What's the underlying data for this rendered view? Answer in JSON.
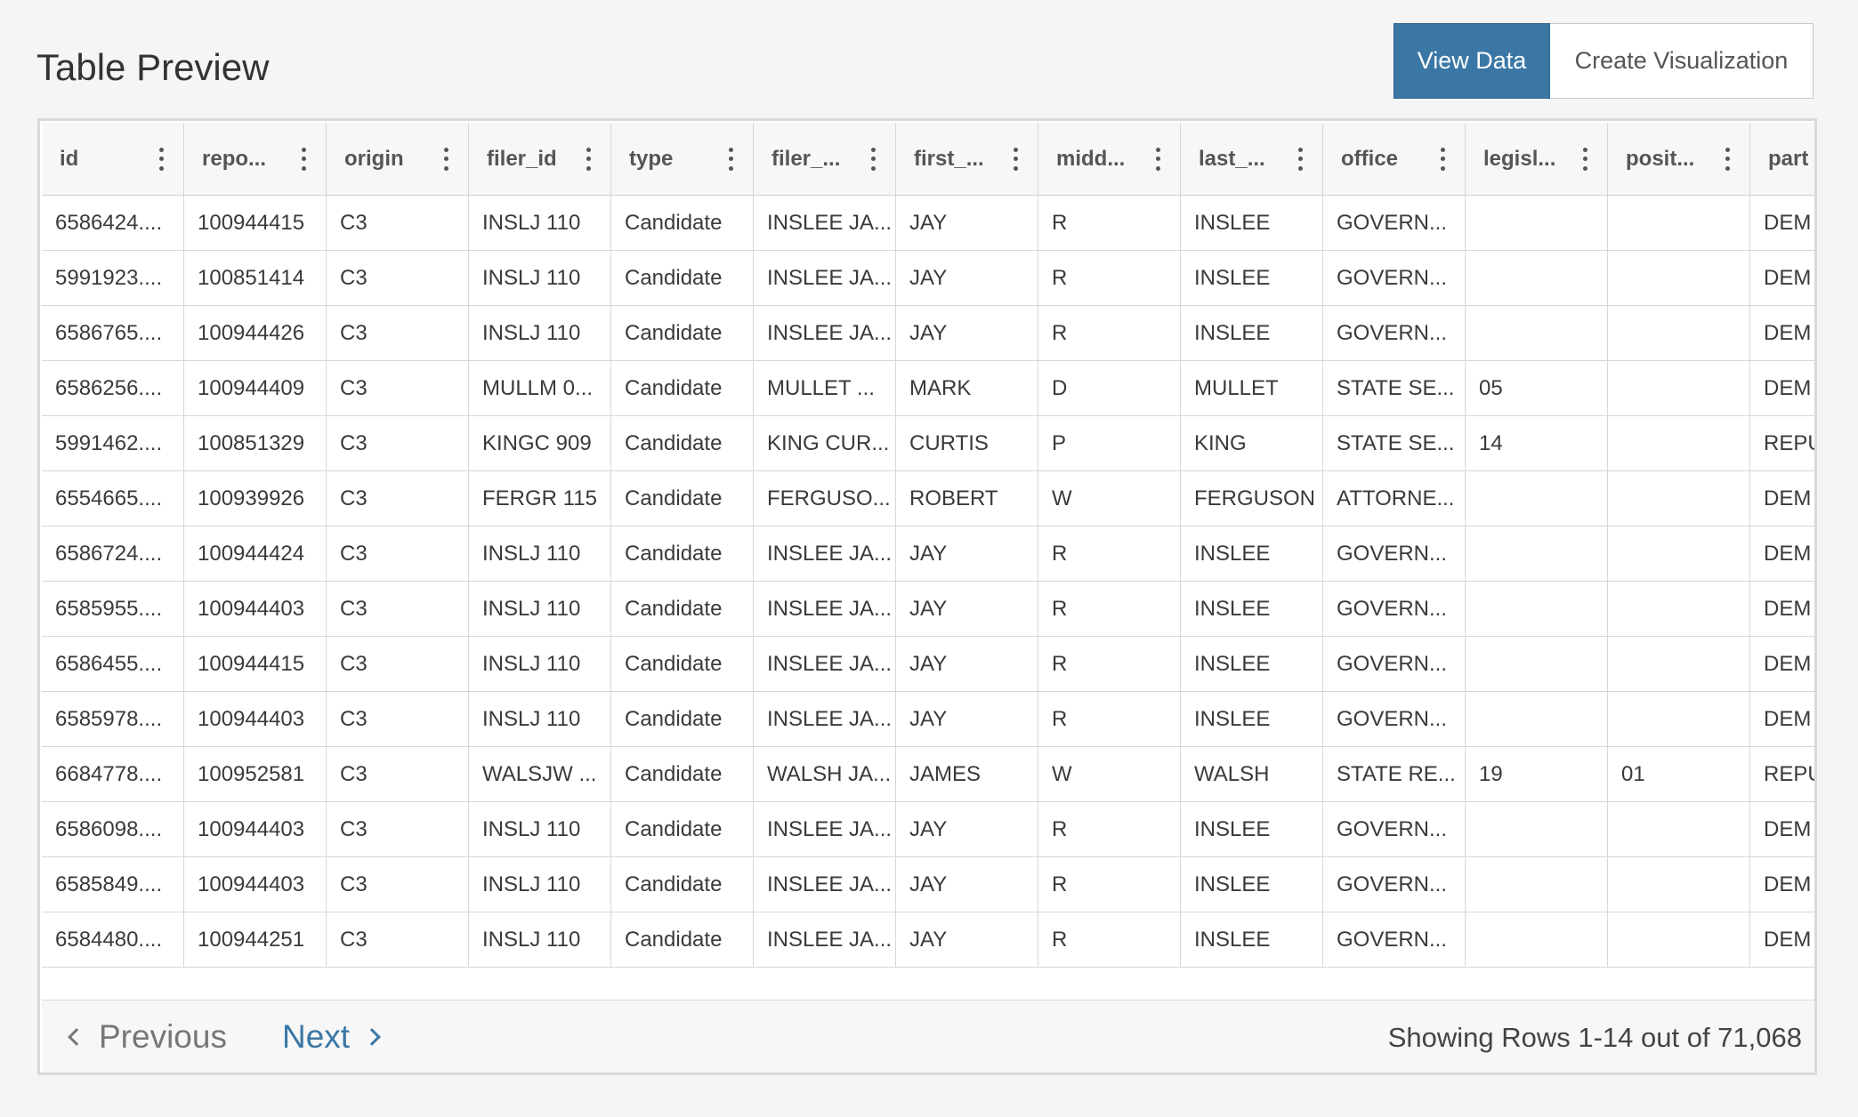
{
  "header": {
    "title": "Table Preview",
    "view_data_label": "View Data",
    "create_viz_label": "Create Visualization"
  },
  "table": {
    "columns": [
      "id",
      "repo...",
      "origin",
      "filer_id",
      "type",
      "filer_...",
      "first_...",
      "midd...",
      "last_...",
      "office",
      "legisl...",
      "posit...",
      "part"
    ],
    "rows": [
      [
        "6586424....",
        "100944415",
        "C3",
        "INSLJ 110",
        "Candidate",
        "INSLEE JA...",
        "JAY",
        "R",
        "INSLEE",
        "GOVERN...",
        "",
        "",
        "DEM"
      ],
      [
        "5991923....",
        "100851414",
        "C3",
        "INSLJ 110",
        "Candidate",
        "INSLEE JA...",
        "JAY",
        "R",
        "INSLEE",
        "GOVERN...",
        "",
        "",
        "DEM"
      ],
      [
        "6586765....",
        "100944426",
        "C3",
        "INSLJ 110",
        "Candidate",
        "INSLEE JA...",
        "JAY",
        "R",
        "INSLEE",
        "GOVERN...",
        "",
        "",
        "DEM"
      ],
      [
        "6586256....",
        "100944409",
        "C3",
        "MULLM 0...",
        "Candidate",
        "MULLET ...",
        "MARK",
        "D",
        "MULLET",
        "STATE SE...",
        "05",
        "",
        "DEM"
      ],
      [
        "5991462....",
        "100851329",
        "C3",
        "KINGC 909",
        "Candidate",
        "KING CUR...",
        "CURTIS",
        "P",
        "KING",
        "STATE SE...",
        "14",
        "",
        "REPU"
      ],
      [
        "6554665....",
        "100939926",
        "C3",
        "FERGR 115",
        "Candidate",
        "FERGUSO...",
        "ROBERT",
        "W",
        "FERGUSON",
        "ATTORNE...",
        "",
        "",
        "DEM"
      ],
      [
        "6586724....",
        "100944424",
        "C3",
        "INSLJ 110",
        "Candidate",
        "INSLEE JA...",
        "JAY",
        "R",
        "INSLEE",
        "GOVERN...",
        "",
        "",
        "DEM"
      ],
      [
        "6585955....",
        "100944403",
        "C3",
        "INSLJ 110",
        "Candidate",
        "INSLEE JA...",
        "JAY",
        "R",
        "INSLEE",
        "GOVERN...",
        "",
        "",
        "DEM"
      ],
      [
        "6586455....",
        "100944415",
        "C3",
        "INSLJ 110",
        "Candidate",
        "INSLEE JA...",
        "JAY",
        "R",
        "INSLEE",
        "GOVERN...",
        "",
        "",
        "DEM"
      ],
      [
        "6585978....",
        "100944403",
        "C3",
        "INSLJ 110",
        "Candidate",
        "INSLEE JA...",
        "JAY",
        "R",
        "INSLEE",
        "GOVERN...",
        "",
        "",
        "DEM"
      ],
      [
        "6684778....",
        "100952581",
        "C3",
        "WALSJW ...",
        "Candidate",
        "WALSH JA...",
        "JAMES",
        "W",
        "WALSH",
        "STATE RE...",
        "19",
        "01",
        "REPU"
      ],
      [
        "6586098....",
        "100944403",
        "C3",
        "INSLJ 110",
        "Candidate",
        "INSLEE JA...",
        "JAY",
        "R",
        "INSLEE",
        "GOVERN...",
        "",
        "",
        "DEM"
      ],
      [
        "6585849....",
        "100944403",
        "C3",
        "INSLJ 110",
        "Candidate",
        "INSLEE JA...",
        "JAY",
        "R",
        "INSLEE",
        "GOVERN...",
        "",
        "",
        "DEM"
      ],
      [
        "6584480....",
        "100944251",
        "C3",
        "INSLJ 110",
        "Candidate",
        "INSLEE JA...",
        "JAY",
        "R",
        "INSLEE",
        "GOVERN...",
        "",
        "",
        "DEM"
      ]
    ]
  },
  "pager": {
    "previous_label": "Previous",
    "next_label": "Next",
    "row_count_text": "Showing Rows 1-14 out of 71,068"
  },
  "colors": {
    "accent": "#3a77a5",
    "background": "#f5f5f5"
  },
  "icons": {
    "column_menu": "kebab-menu-icon",
    "previous": "chevron-left-icon",
    "next": "chevron-right-icon"
  }
}
